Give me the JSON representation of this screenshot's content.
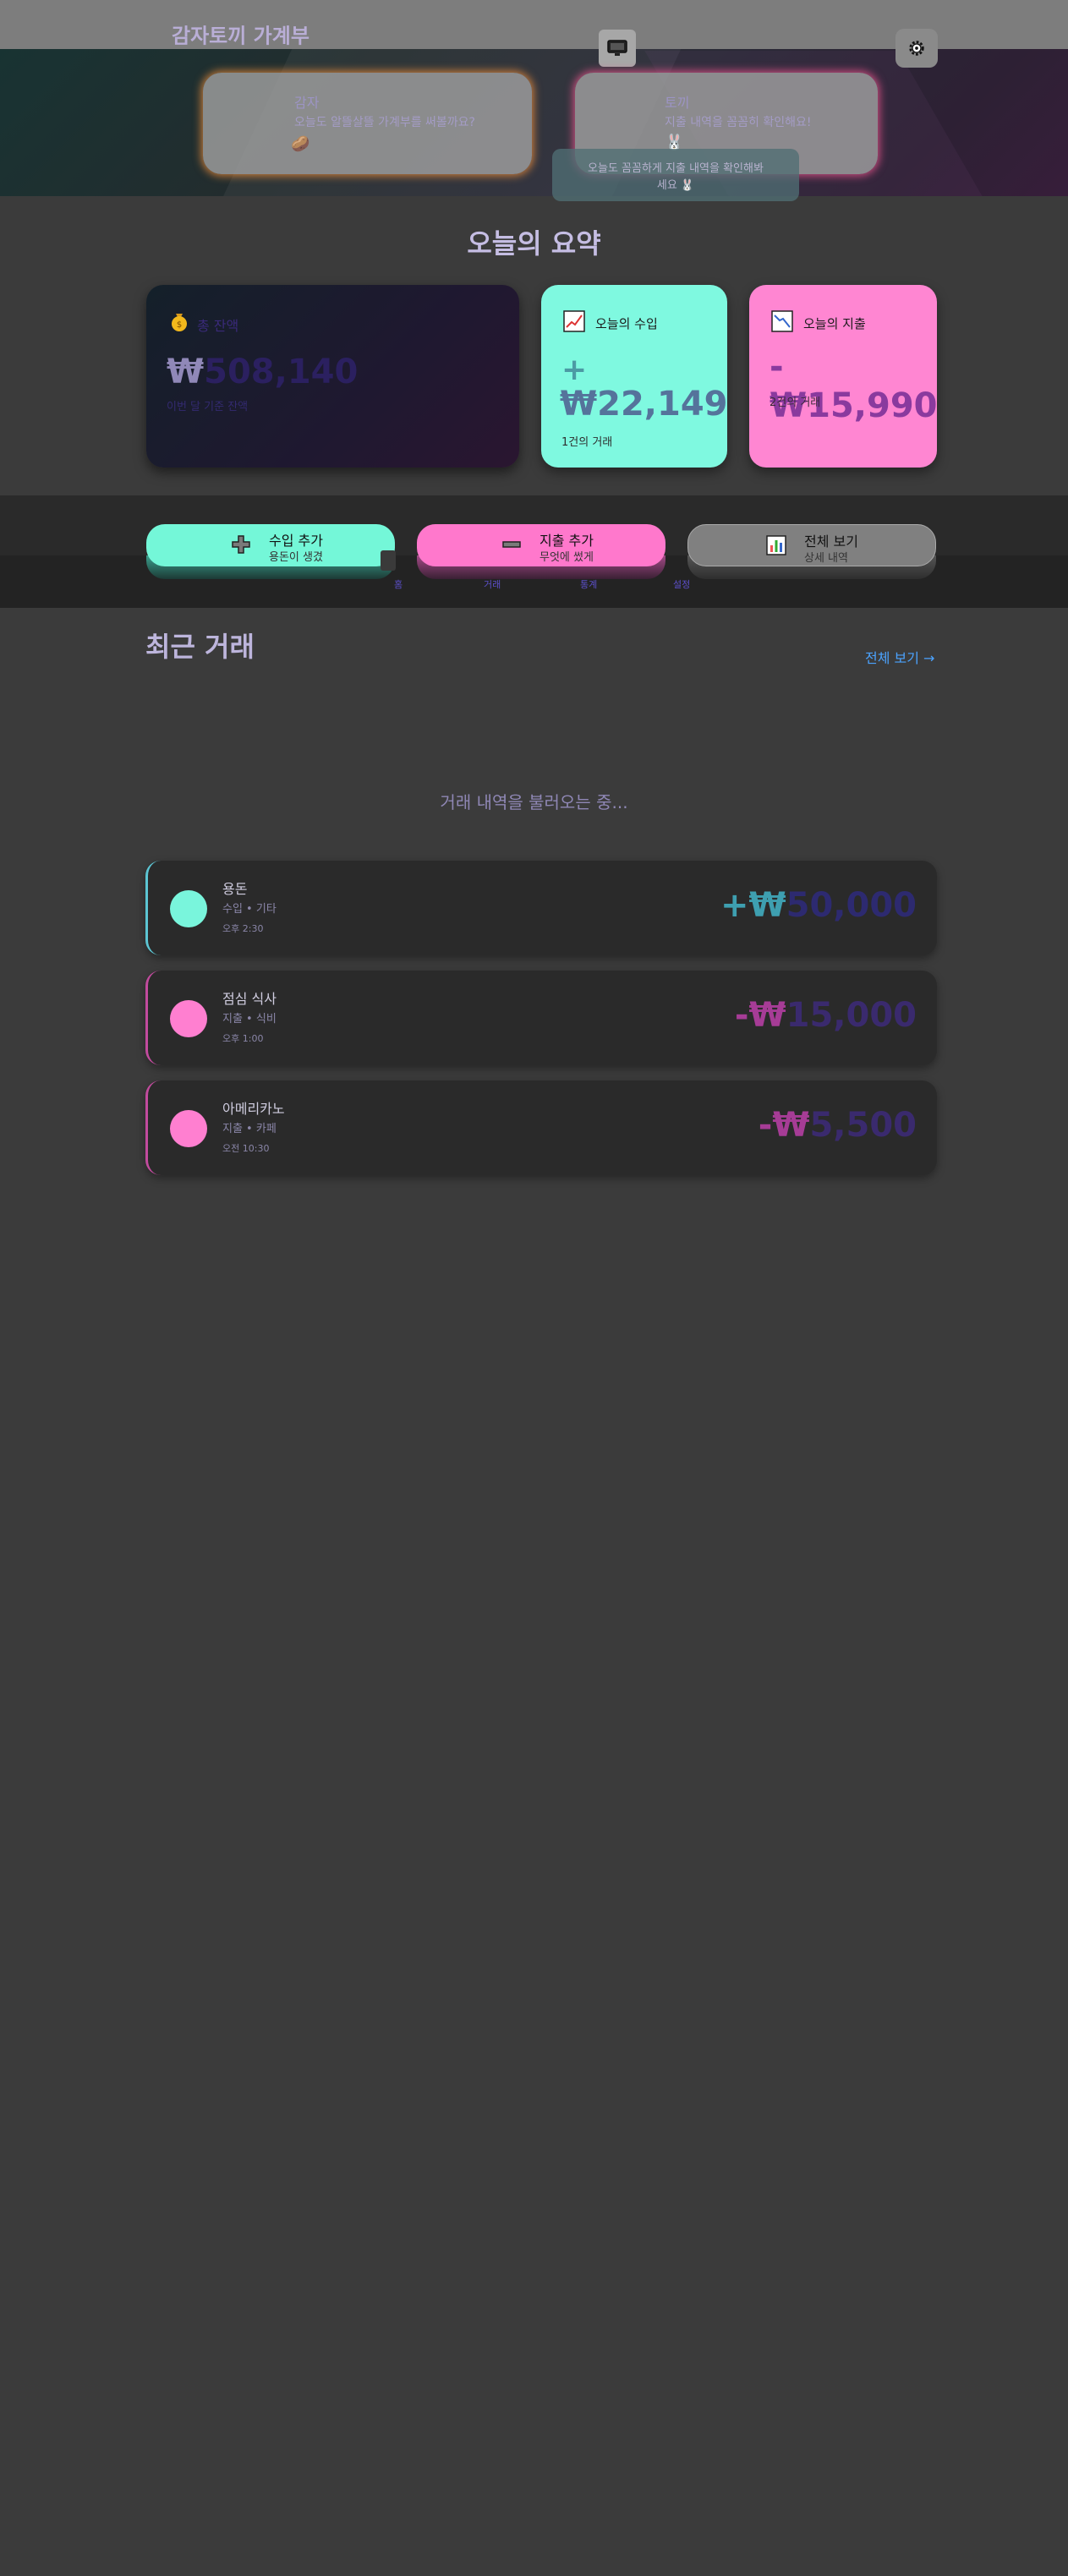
{
  "header": {
    "title": "감자토끼 가계부",
    "monitor_icon": "monitor-icon",
    "settings_icon": "gear-icon"
  },
  "characters": {
    "potato": {
      "name": "감자",
      "message": "오늘도 알뜰살뜰 가계부를 써볼까요?",
      "emoji": "🥔"
    },
    "rabbit": {
      "name": "토끼",
      "message": "지출 내역을 꼼꼼히 확인해요!",
      "emoji": "🐰"
    },
    "tooltip_line1": "오늘도 꼼꼼하게 지출 내역을 확인해봐",
    "tooltip_line2": "세요 🐰"
  },
  "summary": {
    "title": "오늘의 요약",
    "total": {
      "label": "총 잔액",
      "currency": "₩",
      "amount": "508,140",
      "sub": "이번 달 기준 잔액"
    },
    "income": {
      "label": "오늘의 수입",
      "sign": "+",
      "amount": "₩22,149",
      "sub": "1건의 거래"
    },
    "expense": {
      "label": "오늘의 지출",
      "amount": "-₩15,990",
      "sub": "2건의 거래"
    }
  },
  "quick_actions": [
    {
      "title": "수입 추가",
      "sub": "용돈이 생겼"
    },
    {
      "title": "지출 추가",
      "sub": "무엇에 썼게"
    },
    {
      "title": "전체 보기",
      "sub": "상세 내역"
    }
  ],
  "bottom_nav": [
    "홈",
    "거래",
    "통계",
    "설정"
  ],
  "recent": {
    "title": "최근 거래",
    "view_all": "전체 보기 →",
    "loading": "거래 내역을 불러오는 중...",
    "items": [
      {
        "name": "용돈",
        "meta": "수입 • 기타",
        "time": "오후 2:30",
        "sign": "+₩",
        "amount": "50,000"
      },
      {
        "name": "점심 식사",
        "meta": "지출 • 식비",
        "time": "오후 1:00",
        "sign": "-₩",
        "amount": "15,000"
      },
      {
        "name": "아메리카노",
        "meta": "지출 • 카페",
        "time": "오전 10:30",
        "sign": "-₩",
        "amount": "5,500"
      }
    ]
  },
  "colors": {
    "income": "#7ff9e0",
    "expense": "#ff86d2",
    "link": "#4ba3ff"
  }
}
